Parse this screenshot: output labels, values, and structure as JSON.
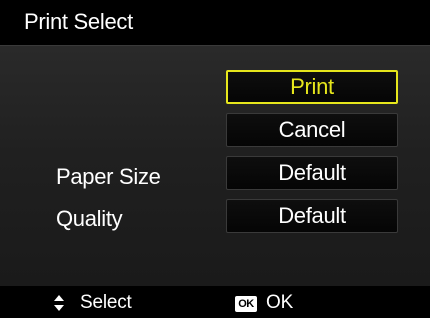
{
  "title": "Print Select",
  "colors": {
    "selection": "#e6e61c",
    "text": "#ffffff",
    "background": "#000000"
  },
  "buttons": {
    "print": "Print",
    "cancel": "Cancel",
    "paper_size_value": "Default",
    "quality_value": "Default"
  },
  "labels": {
    "paper_size": "Paper Size",
    "quality": "Quality"
  },
  "selected": "Print",
  "footer": {
    "select_icon": "up-down-arrows-icon",
    "select_label": "Select",
    "ok_icon_text": "OK",
    "ok_label": "OK"
  }
}
